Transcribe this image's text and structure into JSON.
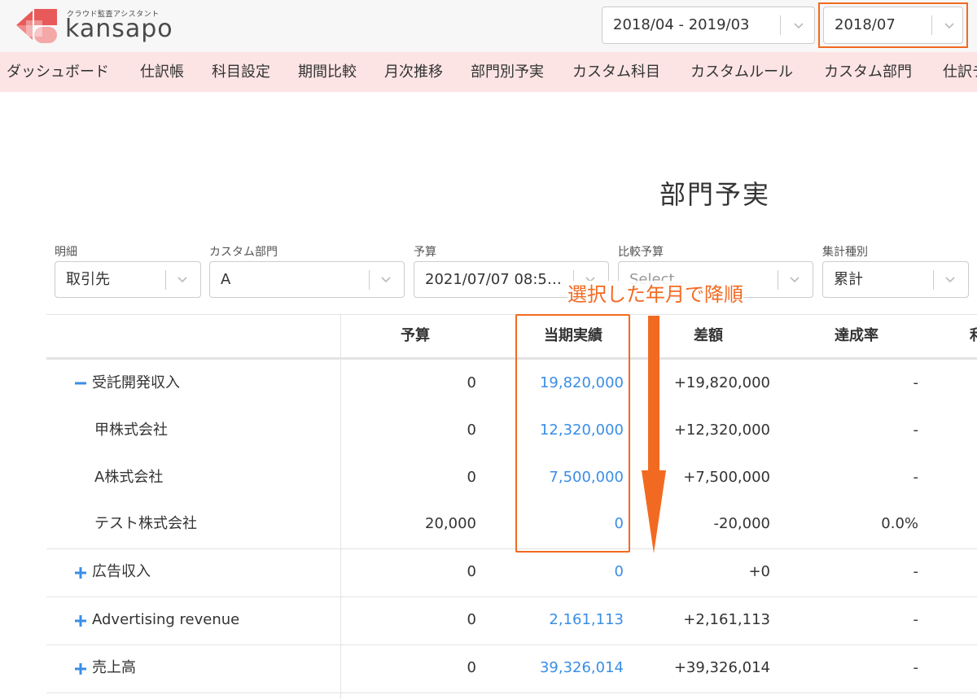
{
  "header": {
    "logo_tagline": "クラウド監査アシスタント",
    "logo_name": "kansapo",
    "period_value": "2018/04 - 2019/03",
    "month_value": "2018/07"
  },
  "nav": {
    "items": [
      {
        "label": "ダッシュボード"
      },
      {
        "label": "仕訳帳"
      },
      {
        "label": "科目設定"
      },
      {
        "label": "期間比較"
      },
      {
        "label": "月次推移"
      },
      {
        "label": "部門別予実"
      },
      {
        "label": "カスタム科目"
      },
      {
        "label": "カスタムルール"
      },
      {
        "label": "カスタム部門"
      },
      {
        "label": "仕訳チ"
      }
    ]
  },
  "page": {
    "title": "部門予実"
  },
  "filters": {
    "detail": {
      "label": "明細",
      "value": "取引先"
    },
    "custom_dept": {
      "label": "カスタム部門",
      "value": "A"
    },
    "budget": {
      "label": "予算",
      "value": "2021/07/07 08:5…"
    },
    "compare_budget": {
      "label": "比較予算",
      "placeholder": "Select..."
    },
    "aggregation": {
      "label": "集計種別",
      "value": "累計"
    }
  },
  "table": {
    "headers": {
      "budget": "予算",
      "actual": "当期実績",
      "diff": "差額",
      "rate": "達成率",
      "extra": "利"
    },
    "rows": [
      {
        "label": "受託開発収入",
        "budget": "0",
        "actual": "19,820,000",
        "diff": "+19,820,000",
        "rate": "-"
      },
      {
        "label": "甲株式会社",
        "budget": "0",
        "actual": "12,320,000",
        "diff": "+12,320,000",
        "rate": "-"
      },
      {
        "label": "A株式会社",
        "budget": "0",
        "actual": "7,500,000",
        "diff": "+7,500,000",
        "rate": "-"
      },
      {
        "label": "テスト株式会社",
        "budget": "20,000",
        "actual": "0",
        "diff": "-20,000",
        "rate": "0.0%"
      },
      {
        "label": "広告収入",
        "budget": "0",
        "actual": "0",
        "diff": "+0",
        "rate": "-"
      },
      {
        "label": "Advertising revenue",
        "budget": "0",
        "actual": "2,161,113",
        "diff": "+2,161,113",
        "rate": "-"
      },
      {
        "label": "売上高",
        "budget": "0",
        "actual": "39,326,014",
        "diff": "+39,326,014",
        "rate": "-"
      }
    ]
  },
  "annotation": {
    "text": "選択した年月で降順",
    "color": "#f26a21"
  },
  "colors": {
    "accent": "#f26a21",
    "link": "#3a8ee6",
    "nav_bg": "#fde4e4",
    "logo_red": "#e85a5a"
  }
}
